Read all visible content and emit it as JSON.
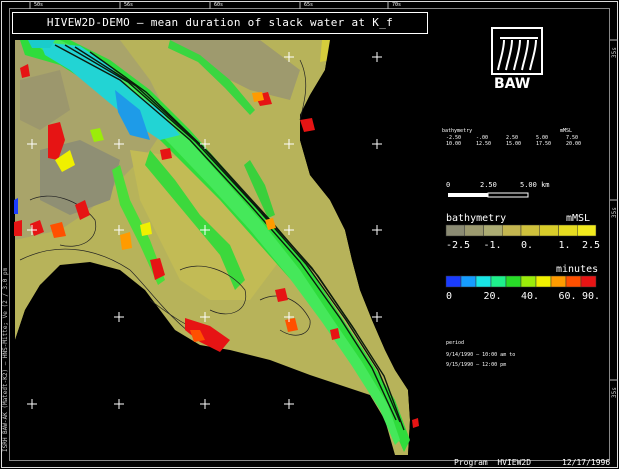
{
  "title": "HIVEW2D-DEMO — mean duration of slack water at K_f",
  "logo": {
    "text": "BAW",
    "icon": "baw-logo-icon"
  },
  "header_small": {
    "line1_label": "bathymetry",
    "line1_unit": "mMSL",
    "row_top": [
      "-2.50",
      "-.00",
      "2.50",
      "5.00",
      "7.50"
    ],
    "row_bottom": [
      "10.00",
      "12.50",
      "15.00",
      "17.50",
      "20.00"
    ]
  },
  "scalebar": {
    "labels": [
      "0",
      "2.50",
      "5.00 km"
    ]
  },
  "bathymetry_legend": {
    "title": "bathymetry",
    "unit": "mMSL",
    "ticks": [
      "-2.5",
      "-1.",
      "0.",
      "1.",
      "2.5"
    ],
    "colors": [
      "#8b8b73",
      "#9c9a6f",
      "#acac73",
      "#c4b650",
      "#cfc13c",
      "#d8cc2a",
      "#e6dc20",
      "#f1ea1d"
    ]
  },
  "minutes_legend": {
    "title": "minutes",
    "ticks": [
      "0",
      "20.",
      "40.",
      "60.",
      "90."
    ],
    "colors": [
      "#1a3cff",
      "#169cff",
      "#19e6e6",
      "#1ef08c",
      "#28dc28",
      "#9bec0a",
      "#f0f000",
      "#ff9b00",
      "#ff5000",
      "#e61414"
    ]
  },
  "event_info": {
    "label": "period",
    "start": "9/14/1990 – 10:00 am to",
    "end": "9/15/1990 – 12:00 pm"
  },
  "left_label": "ISRH BAW-AK (Matedt-K2) — HNS-Mitte; Ve (2 / 3.0 pm",
  "footer": {
    "program": "Program  HVIEW2D",
    "date": "12/17/1996"
  },
  "top_ticks": [
    "50s",
    "56s",
    "60s",
    "65s",
    "70s"
  ],
  "right_ticks": [
    "35s",
    "35s",
    "35s"
  ]
}
